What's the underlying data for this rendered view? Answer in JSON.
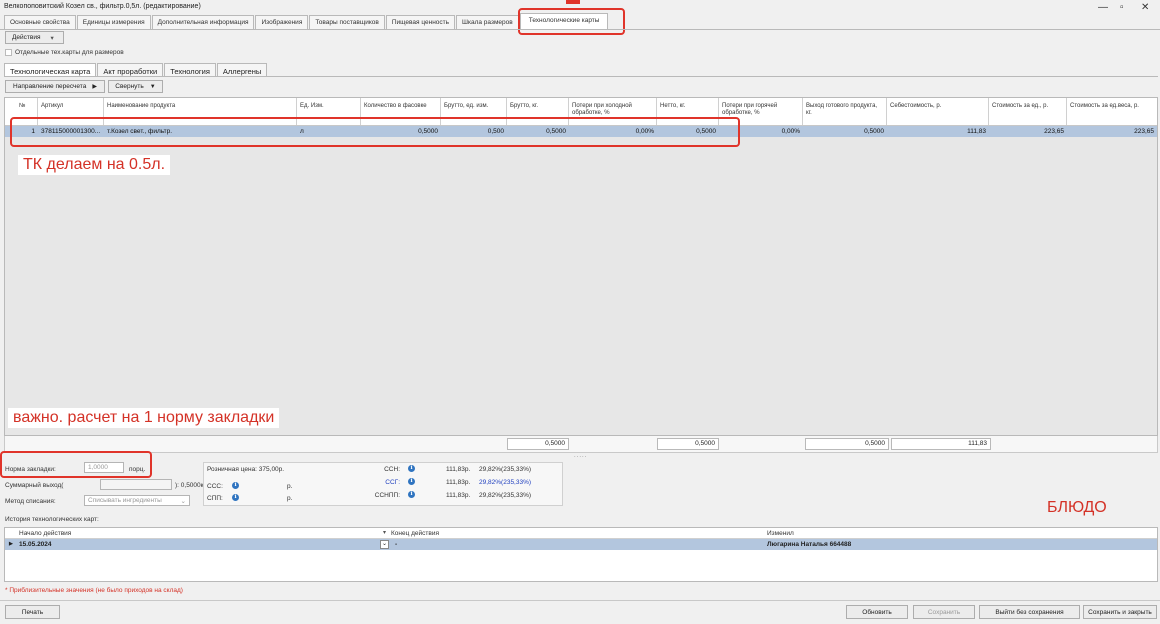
{
  "window": {
    "title": "Велкопоповитский Козел св., фильтр.0,5л. (редактирование)"
  },
  "tabs": [
    "Основные свойства",
    "Единицы измерения",
    "Дополнительная информация",
    "Изображения",
    "Товары поставщиков",
    "Пищевая ценность",
    "Шкала размеров",
    "Технологические карты"
  ],
  "toolbar": {
    "actions": "Действия",
    "size_checkbox": "Отдельные тех.карты для размеров"
  },
  "subtabs": [
    "Технологическая карта",
    "Акт проработки",
    "Технология",
    "Аллергены"
  ],
  "subtoolbar": {
    "recalc": "Направление пересчета",
    "collapse": "Свернуть"
  },
  "table": {
    "columns": [
      "№",
      "Артикул",
      "Наименование продукта",
      "Ед. Изм.",
      "Количество в фасовке",
      "Брутто, ед. изм.",
      "Брутто, кг.",
      "Потери при холодной обработке, %",
      "Нетто, кг.",
      "Потери при горячей обработке, %",
      "Выход готового продукта, кг.",
      "Себестоимость, р.",
      "Стоимость за ед., р.",
      "Стоимость за ед.веса, р."
    ],
    "rows": [
      [
        "1",
        "378115000001300...",
        "т.Козел свет., фильтр.",
        "л",
        "0,5000",
        "0,500",
        "0,5000",
        "0,00%",
        "0,5000",
        "0,00%",
        "0,5000",
        "111,83",
        "223,65",
        "223,65"
      ]
    ],
    "totals": {
      "brutto_kg": "0,5000",
      "netto": "0,5000",
      "vyhod": "0,5000",
      "cost": "111,83"
    }
  },
  "annotations": {
    "tk": "ТК делаем на 0.5л.",
    "norm": "важно. расчет на 1 норму закладки",
    "dish": "БЛЮДО"
  },
  "form": {
    "norm_label": "Норма закладки:",
    "norm_value": "1,0000",
    "norm_unit": "порц.",
    "total_label": "Суммарный выход(",
    "total_suffix": "): 0,5000кг",
    "method_label": "Метод списания:",
    "method_value": "Списывать ингредиенты",
    "retail": "Розничная цена: 375,00р.",
    "ccc": "ССС:",
    "ccc_unit": "р.",
    "spp": "СПП:",
    "spp_unit": "р.",
    "csn": "СCH:",
    "csn_val": "111,83р.",
    "csn_pct": "29,82%(235,33%)",
    "csg": "ССГ:",
    "csg_val": "111,83р.",
    "csg_pct": "29,82%(235,33%)",
    "csnpp": "ССНПП:",
    "csnpp_val": "111,83р.",
    "csnpp_pct": "29,82%(235,33%)"
  },
  "history": {
    "title": "История технологических карт:",
    "col_start": "Начало действия",
    "col_end": "Конец действия",
    "col_changed": "Изменил",
    "start": "15.05.2024",
    "end": "-",
    "changed_by": "Люгарина Наталья 664488"
  },
  "footnote": "Приблизительные значения (не было приходов на склад)",
  "buttons": {
    "print": "Печать",
    "refresh": "Обновить",
    "save": "Сохранить",
    "exit": "Выйти без сохранения",
    "save_close": "Сохранить и закрыть"
  },
  "colors": {
    "accent_red": "#e0342a",
    "selected_row": "#b3c6de",
    "info_blue": "#2f74c0",
    "link_blue": "#1f3fbf"
  }
}
